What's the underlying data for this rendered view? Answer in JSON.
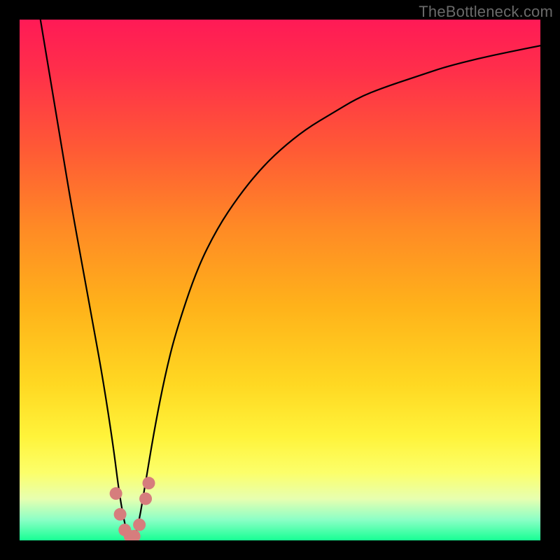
{
  "watermark": "TheBottleneck.com",
  "colors": {
    "frame": "#000000",
    "curve": "#000000",
    "marker": "#d67d7d",
    "gradient_stops": [
      {
        "offset": 0.0,
        "color": "#ff1a56"
      },
      {
        "offset": 0.1,
        "color": "#ff2f4a"
      },
      {
        "offset": 0.25,
        "color": "#ff5a35"
      },
      {
        "offset": 0.4,
        "color": "#ff8a25"
      },
      {
        "offset": 0.55,
        "color": "#ffb21a"
      },
      {
        "offset": 0.7,
        "color": "#ffd822"
      },
      {
        "offset": 0.8,
        "color": "#fff33a"
      },
      {
        "offset": 0.87,
        "color": "#fcff6a"
      },
      {
        "offset": 0.92,
        "color": "#e7ffb0"
      },
      {
        "offset": 0.96,
        "color": "#8cffc6"
      },
      {
        "offset": 1.0,
        "color": "#17ff94"
      }
    ]
  },
  "chart_data": {
    "type": "line",
    "title": "",
    "xlabel": "",
    "ylabel": "",
    "xlim": [
      0,
      100
    ],
    "ylim": [
      0,
      100
    ],
    "grid": false,
    "legend": false,
    "series": [
      {
        "name": "curve",
        "x": [
          4,
          6,
          8,
          10,
          12,
          14,
          16,
          18,
          19,
          20,
          21,
          22,
          23,
          24,
          26,
          28,
          30,
          34,
          38,
          42,
          46,
          50,
          55,
          60,
          65,
          70,
          76,
          82,
          88,
          94,
          100
        ],
        "y": [
          100,
          88,
          76,
          64,
          53,
          42,
          31,
          18,
          10,
          4,
          0,
          0,
          4,
          10,
          22,
          32,
          40,
          52,
          60,
          66,
          71,
          75,
          79,
          82,
          85,
          87,
          89,
          91,
          92.5,
          93.8,
          95
        ]
      }
    ],
    "markers": [
      {
        "x": 18.5,
        "y": 9
      },
      {
        "x": 19.3,
        "y": 5
      },
      {
        "x": 20.2,
        "y": 2
      },
      {
        "x": 21.2,
        "y": 0.8
      },
      {
        "x": 22.0,
        "y": 0.8
      },
      {
        "x": 23.0,
        "y": 3
      },
      {
        "x": 24.2,
        "y": 8
      },
      {
        "x": 24.8,
        "y": 11
      }
    ],
    "annotations": []
  }
}
